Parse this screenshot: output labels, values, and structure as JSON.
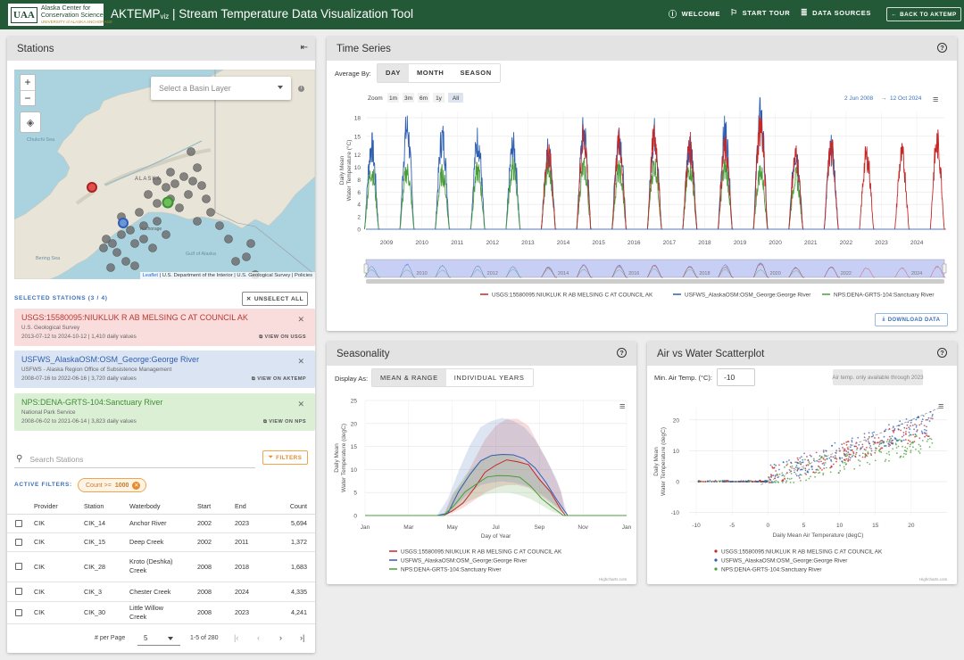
{
  "header": {
    "logo_mark": "UAA",
    "logo_line1": "Alaska Center for",
    "logo_line2": "Conservation Science",
    "logo_line3": "UNIVERSITY of ALASKA ANCHORAGE",
    "title_main": "AKTEMP",
    "title_sub": "viz",
    "title_rest": " | Stream Temperature Data Visualization Tool",
    "nav_welcome": "WELCOME",
    "nav_tour": "START TOUR",
    "nav_sources": "DATA SOURCES",
    "back_label": "BACK TO AKTEMP"
  },
  "stations_panel": {
    "title": "Stations",
    "basin_placeholder": "Select a Basin Layer",
    "map_labels": {
      "chukchi": "Chukchi Sea",
      "alaska": "ALASKA",
      "bering": "Bering Sea",
      "gulf": "Gulf of Alaska",
      "anchorage": "Anchorage"
    },
    "attribution_leaflet": "Leaflet",
    "attribution_rest": " | U.S. Department of the Interior | U.S. Geological Survey | Policies",
    "selected_label": "SELECTED STATIONS (3 / 4)",
    "unselect_label": "UNSELECT ALL",
    "cards": [
      {
        "name": "USGS:15580095:NIUKLUK R AB MELSING C AT COUNCIL AK",
        "org": "U.S. Geological Survey",
        "dates": "2013-07-12 to 2024-10-12 | 1,410 daily values",
        "link": "VIEW ON USGS",
        "color": "#d8453c",
        "bg": "#f9dcdc"
      },
      {
        "name": "USFWS_AlaskaOSM:OSM_George:George River",
        "org": "USFWS - Alaska Region Office of Subsistence Management",
        "dates": "2008-07-16 to 2022-06-16 | 3,720 daily values",
        "link": "VIEW ON AKTEMP",
        "color": "#3a66b0",
        "bg": "#dae4f2"
      },
      {
        "name": "NPS:DENA-GRTS-104:Sanctuary River",
        "org": "National Park Service",
        "dates": "2008-06-02 to 2021-06-14 | 3,823 daily values",
        "link": "VIEW ON NPS",
        "color": "#4e9e3e",
        "bg": "#dbefd5"
      }
    ],
    "search_placeholder": "Search Stations",
    "filters_label": "FILTERS",
    "active_filters_label": "ACTIVE FILTERS:",
    "chip_label": "Count >=",
    "chip_value": "1000",
    "table_headers": [
      "Provider",
      "Station",
      "Waterbody",
      "Start",
      "End",
      "Count"
    ],
    "rows": [
      {
        "provider": "CIK",
        "station": "CIK_14",
        "waterbody": "Anchor River",
        "start": "2002",
        "end": "2023",
        "count": "5,694"
      },
      {
        "provider": "CIK",
        "station": "CIK_15",
        "waterbody": "Deep Creek",
        "start": "2002",
        "end": "2011",
        "count": "1,372"
      },
      {
        "provider": "CIK",
        "station": "CIK_28",
        "waterbody": "Kroto (Deshka) Creek",
        "start": "2008",
        "end": "2018",
        "count": "1,683"
      },
      {
        "provider": "CIK",
        "station": "CIK_3",
        "waterbody": "Chester Creek",
        "start": "2008",
        "end": "2024",
        "count": "4,335"
      },
      {
        "provider": "CIK",
        "station": "CIK_30",
        "waterbody": "Little Willow Creek",
        "start": "2008",
        "end": "2023",
        "count": "4,241"
      }
    ],
    "per_page_label": "# per Page",
    "per_page_value": "5",
    "range_label": "1-5 of 280"
  },
  "timeseries": {
    "title": "Time Series",
    "avg_label": "Average By:",
    "avg_options": [
      "DAY",
      "MONTH",
      "SEASON"
    ],
    "zoom_label": "Zoom",
    "zoom_options": [
      "1m",
      "3m",
      "6m",
      "1y",
      "All"
    ],
    "range_from": "2 Jun 2008",
    "range_arrow": "→",
    "range_to": "12 Oct 2024",
    "download_label": "DOWNLOAD DATA"
  },
  "seasonality": {
    "title": "Seasonality",
    "display_label": "Display As:",
    "options": [
      "MEAN & RANGE",
      "INDIVIDUAL YEARS"
    ]
  },
  "scatter": {
    "title": "Air vs Water Scatterplot",
    "min_air_label": "Min. Air Temp. (°C):",
    "min_air_value": "-10",
    "note": "Air temp. only available through 2023"
  },
  "credit": "Highcharts.com",
  "chart_data": [
    {
      "type": "line",
      "id": "timeseries",
      "ylabel": "Daily Mean Water Temperature (°C)",
      "xlabel": "",
      "x_ticks": [
        "2009",
        "2010",
        "2011",
        "2012",
        "2013",
        "2014",
        "2015",
        "2016",
        "2017",
        "2018",
        "2019",
        "2020",
        "2021",
        "2022",
        "2023",
        "2024"
      ],
      "y_ticks": [
        0,
        2,
        4,
        6,
        8,
        10,
        12,
        15,
        18
      ],
      "xlim": [
        2008.42,
        2024.78
      ],
      "ylim": [
        0,
        19
      ],
      "navigator_ticks": [
        "2010",
        "2012",
        "2014",
        "2016",
        "2018",
        "2020",
        "2022",
        "2024"
      ],
      "series": [
        {
          "name": "USGS:15580095:NIUKLUK R AB MELSING C AT COUNCIL AK",
          "color": "#c62828",
          "years": [
            2013,
            2014,
            2015,
            2016,
            2017,
            2018,
            2019,
            2020,
            2021,
            2022,
            2023,
            2024
          ],
          "peaks": [
            12.5,
            15,
            14,
            15,
            13.5,
            13,
            17,
            12,
            13,
            12,
            12,
            14
          ]
        },
        {
          "name": "USFWS_AlaskaOSM:OSM_George:George River",
          "color": "#2f5fb0",
          "years": [
            2008,
            2009,
            2010,
            2011,
            2012,
            2013,
            2014,
            2015,
            2016,
            2017,
            2018,
            2019,
            2020,
            2021
          ],
          "peaks": [
            13.5,
            16.5,
            15,
            14.5,
            13.5,
            13,
            16,
            15.5,
            15.5,
            14,
            16,
            18.5,
            12.5,
            13
          ]
        },
        {
          "name": "NPS:DENA-GRTS-104:Sanctuary River",
          "color": "#4a9d3b",
          "years": [
            2008,
            2009,
            2010,
            2011,
            2012,
            2013,
            2014,
            2015,
            2016,
            2017,
            2018,
            2019,
            2020
          ],
          "peaks": [
            9.5,
            9.5,
            9,
            9.5,
            10,
            10.5,
            10,
            9.5,
            10.5,
            10,
            10,
            9.5,
            8.5
          ]
        }
      ]
    },
    {
      "type": "area",
      "id": "seasonality",
      "ylabel": "Daily Mean Water Temperature (degC)",
      "xlabel": "Day of Year",
      "x_ticks": [
        "Jan",
        "Mar",
        "May",
        "Jul",
        "Sep",
        "Nov",
        "Jan"
      ],
      "y_ticks": [
        0,
        5,
        10,
        15,
        20,
        25
      ],
      "ylim": [
        0,
        25
      ],
      "series": [
        {
          "name": "USGS:15580095:NIUKLUK R AB MELSING C AT COUNCIL AK",
          "color": "#c62828",
          "month": [
            4.6,
            5,
            5.5,
            6,
            6.5,
            7,
            7.5,
            8,
            8.5,
            9,
            9.5,
            10,
            10.2
          ],
          "mean": [
            0,
            1,
            3,
            6,
            9,
            11,
            12,
            12,
            11,
            8,
            5,
            1.5,
            0
          ]
        },
        {
          "name": "USFWS_AlaskaOSM:OSM_George:George River",
          "color": "#2f5fb0",
          "month": [
            4.3,
            4.8,
            5.3,
            5.8,
            6.3,
            6.8,
            7.3,
            7.8,
            8.3,
            8.8,
            9.3,
            9.8,
            10.3
          ],
          "mean": [
            0,
            0.5,
            5,
            9,
            12,
            13,
            13.5,
            13,
            12,
            10,
            7,
            3.5,
            0
          ]
        },
        {
          "name": "NPS:DENA-GRTS-104:Sanctuary River",
          "color": "#4a9d3b",
          "month": [
            4.6,
            5.1,
            5.6,
            6.1,
            6.6,
            7.1,
            7.6,
            8.1,
            8.6,
            9.1,
            9.6,
            10.1
          ],
          "mean": [
            0,
            2,
            5,
            7,
            8.5,
            9,
            9,
            8,
            6.5,
            4,
            1.5,
            0
          ]
        }
      ]
    },
    {
      "type": "scatter",
      "id": "scatter",
      "ylabel": "Daily Mean Water Temperature (degC)",
      "xlabel": "Daily Mean Air Temperature (degC)",
      "x_ticks": [
        -10,
        -5,
        0,
        5,
        10,
        15,
        20
      ],
      "y_ticks": [
        -10,
        0,
        10,
        20
      ],
      "xlim": [
        -11,
        25
      ],
      "ylim": [
        -11,
        24
      ],
      "series": [
        {
          "name": "USGS:15580095:NIUKLUK R AB MELSING C AT COUNCIL AK",
          "color": "#c62828",
          "slope": 0.72,
          "intercept": 1.5
        },
        {
          "name": "USFWS_AlaskaOSM:OSM_George:George River",
          "color": "#2f5fb0",
          "slope": 0.78,
          "intercept": 1.8
        },
        {
          "name": "NPS:DENA-GRTS-104:Sanctuary River",
          "color": "#4a9d3b",
          "slope": 0.55,
          "intercept": 0.8
        }
      ]
    }
  ]
}
